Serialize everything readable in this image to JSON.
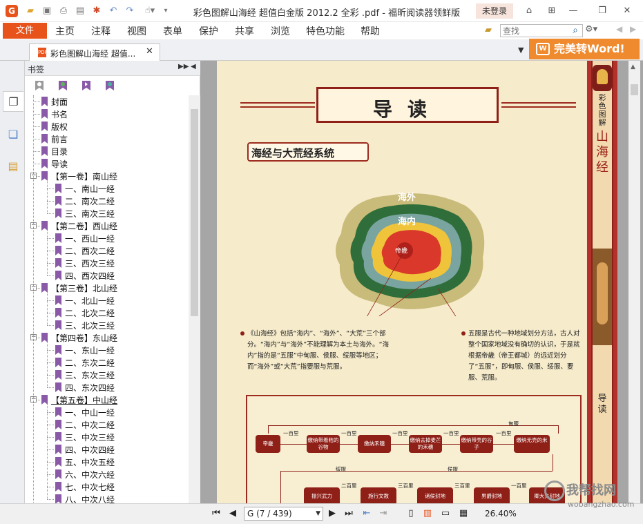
{
  "titlebar": {
    "logo": "G",
    "title": "彩色图解山海经 超值白金版 2012.2 全彩 .pdf - 福昕阅读器领鲜版",
    "login": "未登录"
  },
  "menubar": {
    "file": "文件",
    "items": [
      "主页",
      "注释",
      "视图",
      "表单",
      "保护",
      "共享",
      "浏览",
      "特色功能",
      "帮助"
    ],
    "search_placeholder": "查找"
  },
  "tabs": {
    "doc_tab": "彩色图解山海经 超值...",
    "convert_button": "完美转Word!"
  },
  "bookmarks": {
    "title": "书签",
    "items": [
      {
        "label": "封面",
        "level": 0
      },
      {
        "label": "书名",
        "level": 0
      },
      {
        "label": "版权",
        "level": 0
      },
      {
        "label": "前言",
        "level": 0
      },
      {
        "label": "目录",
        "level": 0
      },
      {
        "label": "导读",
        "level": 0
      },
      {
        "label": "【第一卷】南山经",
        "level": 0,
        "expanded": true
      },
      {
        "label": "一、南山一经",
        "level": 1
      },
      {
        "label": "二、南次二经",
        "level": 1
      },
      {
        "label": "三、南次三经",
        "level": 1
      },
      {
        "label": "【第二卷】西山经",
        "level": 0,
        "expanded": true
      },
      {
        "label": "一、西山一经",
        "level": 1
      },
      {
        "label": "二、西次二经",
        "level": 1
      },
      {
        "label": "三、西次三经",
        "level": 1
      },
      {
        "label": "四、西次四经",
        "level": 1
      },
      {
        "label": "【第三卷】北山经",
        "level": 0,
        "expanded": true
      },
      {
        "label": "一、北山一经",
        "level": 1
      },
      {
        "label": "二、北次二经",
        "level": 1
      },
      {
        "label": "三、北次三经",
        "level": 1
      },
      {
        "label": "【第四卷】东山经",
        "level": 0,
        "expanded": true
      },
      {
        "label": "一、东山一经",
        "level": 1
      },
      {
        "label": "二、东次二经",
        "level": 1
      },
      {
        "label": "三、东次三经",
        "level": 1
      },
      {
        "label": "四、东次四经",
        "level": 1
      },
      {
        "label": "【第五卷】中山经",
        "level": 0,
        "expanded": true,
        "selected": true
      },
      {
        "label": "一、中山一经",
        "level": 1
      },
      {
        "label": "二、中次二经",
        "level": 1
      },
      {
        "label": "三、中次三经",
        "level": 1
      },
      {
        "label": "四、中次四经",
        "level": 1
      },
      {
        "label": "五、中次五经",
        "level": 1
      },
      {
        "label": "六、中次六经",
        "level": 1
      },
      {
        "label": "七、中次七经",
        "level": 1
      },
      {
        "label": "八、中次八经",
        "level": 1
      }
    ]
  },
  "page": {
    "heading": "导读",
    "section_title": "海经与大荒经系统",
    "band_sub": "彩色图解",
    "band_title": "山海经",
    "band_section": "导读",
    "map_outer_label": "海外",
    "map_inner_label": "海内",
    "map_center_label": "帝畿",
    "para_left": "《山海经》包括“海内”、“海外”、“大荒”三个部分。“海内”与“海外”不能理解为本土与海外。“海内”指的是“五服”中甸服、侯服、绥服等地区；而“海外”或“大荒”指要服与荒服。",
    "para_right": "五服是古代一种地域划分方法，古人对整个国家地域没有确切的认识，于是就根据帝畿（帝王都城）的远近划分了“五服”，即甸服、侯服、绥服、要服、荒服。",
    "flow": {
      "top_group": "甸服",
      "mid_left_group": "绥服",
      "mid_right_group": "侯服",
      "top_nodes": [
        "帝畿",
        "缴纳带着秸的谷物",
        "缴纳禾穗",
        "缴纳去掉麦芒的禾穗",
        "缴纳带壳的谷子",
        "缴纳无壳的米"
      ],
      "top_dist": [
        "一百里",
        "一百里",
        "一百里",
        "一百里",
        "一百里"
      ],
      "bottom_nodes": [
        "振兴武力",
        "施行文教",
        "诸侯封地",
        "男爵封地",
        "卿大夫封地"
      ],
      "bottom_dist": [
        "二百里",
        "三百里",
        "三百里",
        "一百里"
      ]
    }
  },
  "statusbar": {
    "page_indicator": "G (7 / 439)",
    "zoom": "26.40%"
  },
  "watermark": {
    "text": "我帮找网",
    "url": "wobangzhao.com"
  }
}
